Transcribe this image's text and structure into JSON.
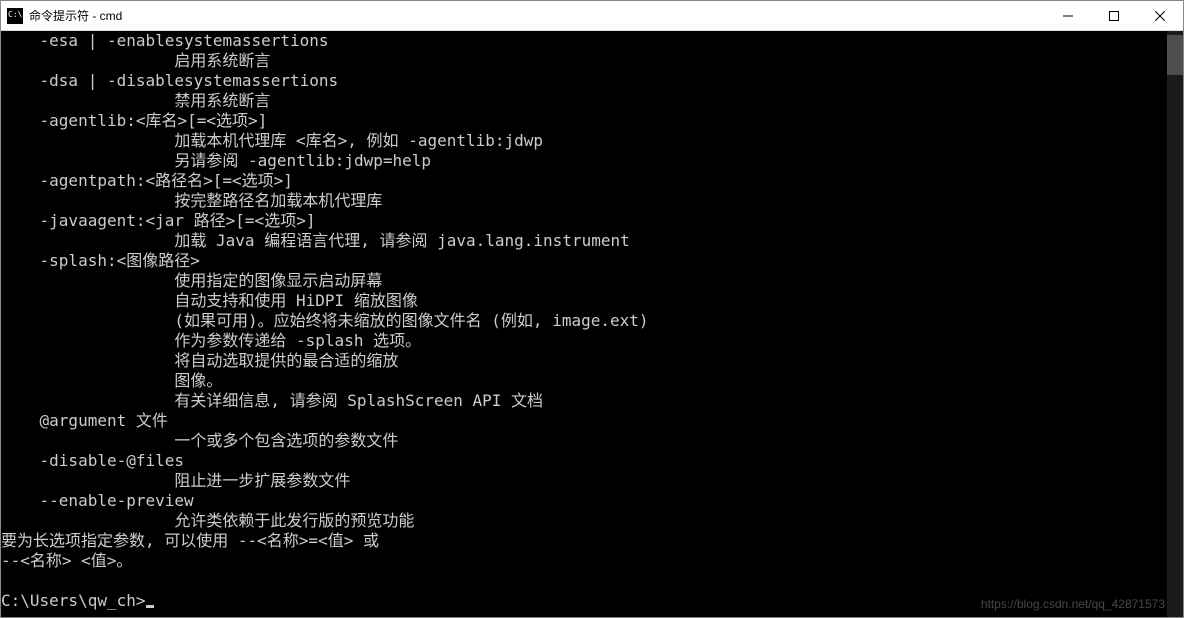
{
  "window": {
    "title": "命令提示符 - cmd"
  },
  "terminal": {
    "lines": [
      "    -esa | -enablesystemassertions",
      "                  启用系统断言",
      "    -dsa | -disablesystemassertions",
      "                  禁用系统断言",
      "    -agentlib:<库名>[=<选项>]",
      "                  加载本机代理库 <库名>, 例如 -agentlib:jdwp",
      "                  另请参阅 -agentlib:jdwp=help",
      "    -agentpath:<路径名>[=<选项>]",
      "                  按完整路径名加载本机代理库",
      "    -javaagent:<jar 路径>[=<选项>]",
      "                  加载 Java 编程语言代理, 请参阅 java.lang.instrument",
      "    -splash:<图像路径>",
      "                  使用指定的图像显示启动屏幕",
      "                  自动支持和使用 HiDPI 缩放图像",
      "                  (如果可用)。应始终将未缩放的图像文件名 (例如, image.ext)",
      "                  作为参数传递给 -splash 选项。",
      "                  将自动选取提供的最合适的缩放",
      "                  图像。",
      "                  有关详细信息, 请参阅 SplashScreen API 文档",
      "    @argument 文件",
      "                  一个或多个包含选项的参数文件",
      "    -disable-@files",
      "                  阻止进一步扩展参数文件",
      "    --enable-preview",
      "                  允许类依赖于此发行版的预览功能",
      "要为长选项指定参数, 可以使用 --<名称>=<值> 或",
      "--<名称> <值>。",
      ""
    ],
    "prompt": "C:\\Users\\qw_ch>"
  },
  "watermark": "https://blog.csdn.net/qq_42871573"
}
